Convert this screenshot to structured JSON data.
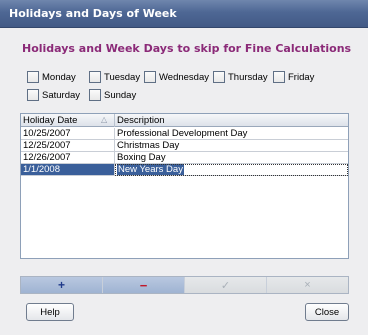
{
  "window": {
    "title": "Holidays and Days of Week"
  },
  "heading": "Holidays and Week Days to skip for Fine Calculations",
  "days": [
    {
      "label": "Monday",
      "checked": false
    },
    {
      "label": "Tuesday",
      "checked": false
    },
    {
      "label": "Wednesday",
      "checked": false
    },
    {
      "label": "Thursday",
      "checked": false
    },
    {
      "label": "Friday",
      "checked": false
    },
    {
      "label": "Saturday",
      "checked": false
    },
    {
      "label": "Sunday",
      "checked": false
    }
  ],
  "grid": {
    "columns": [
      "Holiday Date",
      "Description"
    ],
    "sort_icon": "sort-ascending-icon",
    "rows": [
      {
        "date": "10/25/2007",
        "description": "Professional Development Day"
      },
      {
        "date": "12/25/2007",
        "description": "Christmas Day"
      },
      {
        "date": "12/26/2007",
        "description": "Boxing Day"
      },
      {
        "date": "1/1/2008",
        "description": "New Years Day",
        "selected": true
      }
    ]
  },
  "navigator": {
    "add": "+",
    "delete": "−",
    "post": "✓",
    "cancel": "×"
  },
  "buttons": {
    "help": "Help",
    "close": "Close"
  },
  "colors": {
    "titlebar": "#4e6794",
    "heading": "#8b2a78",
    "selection": "#3a5f9a"
  }
}
